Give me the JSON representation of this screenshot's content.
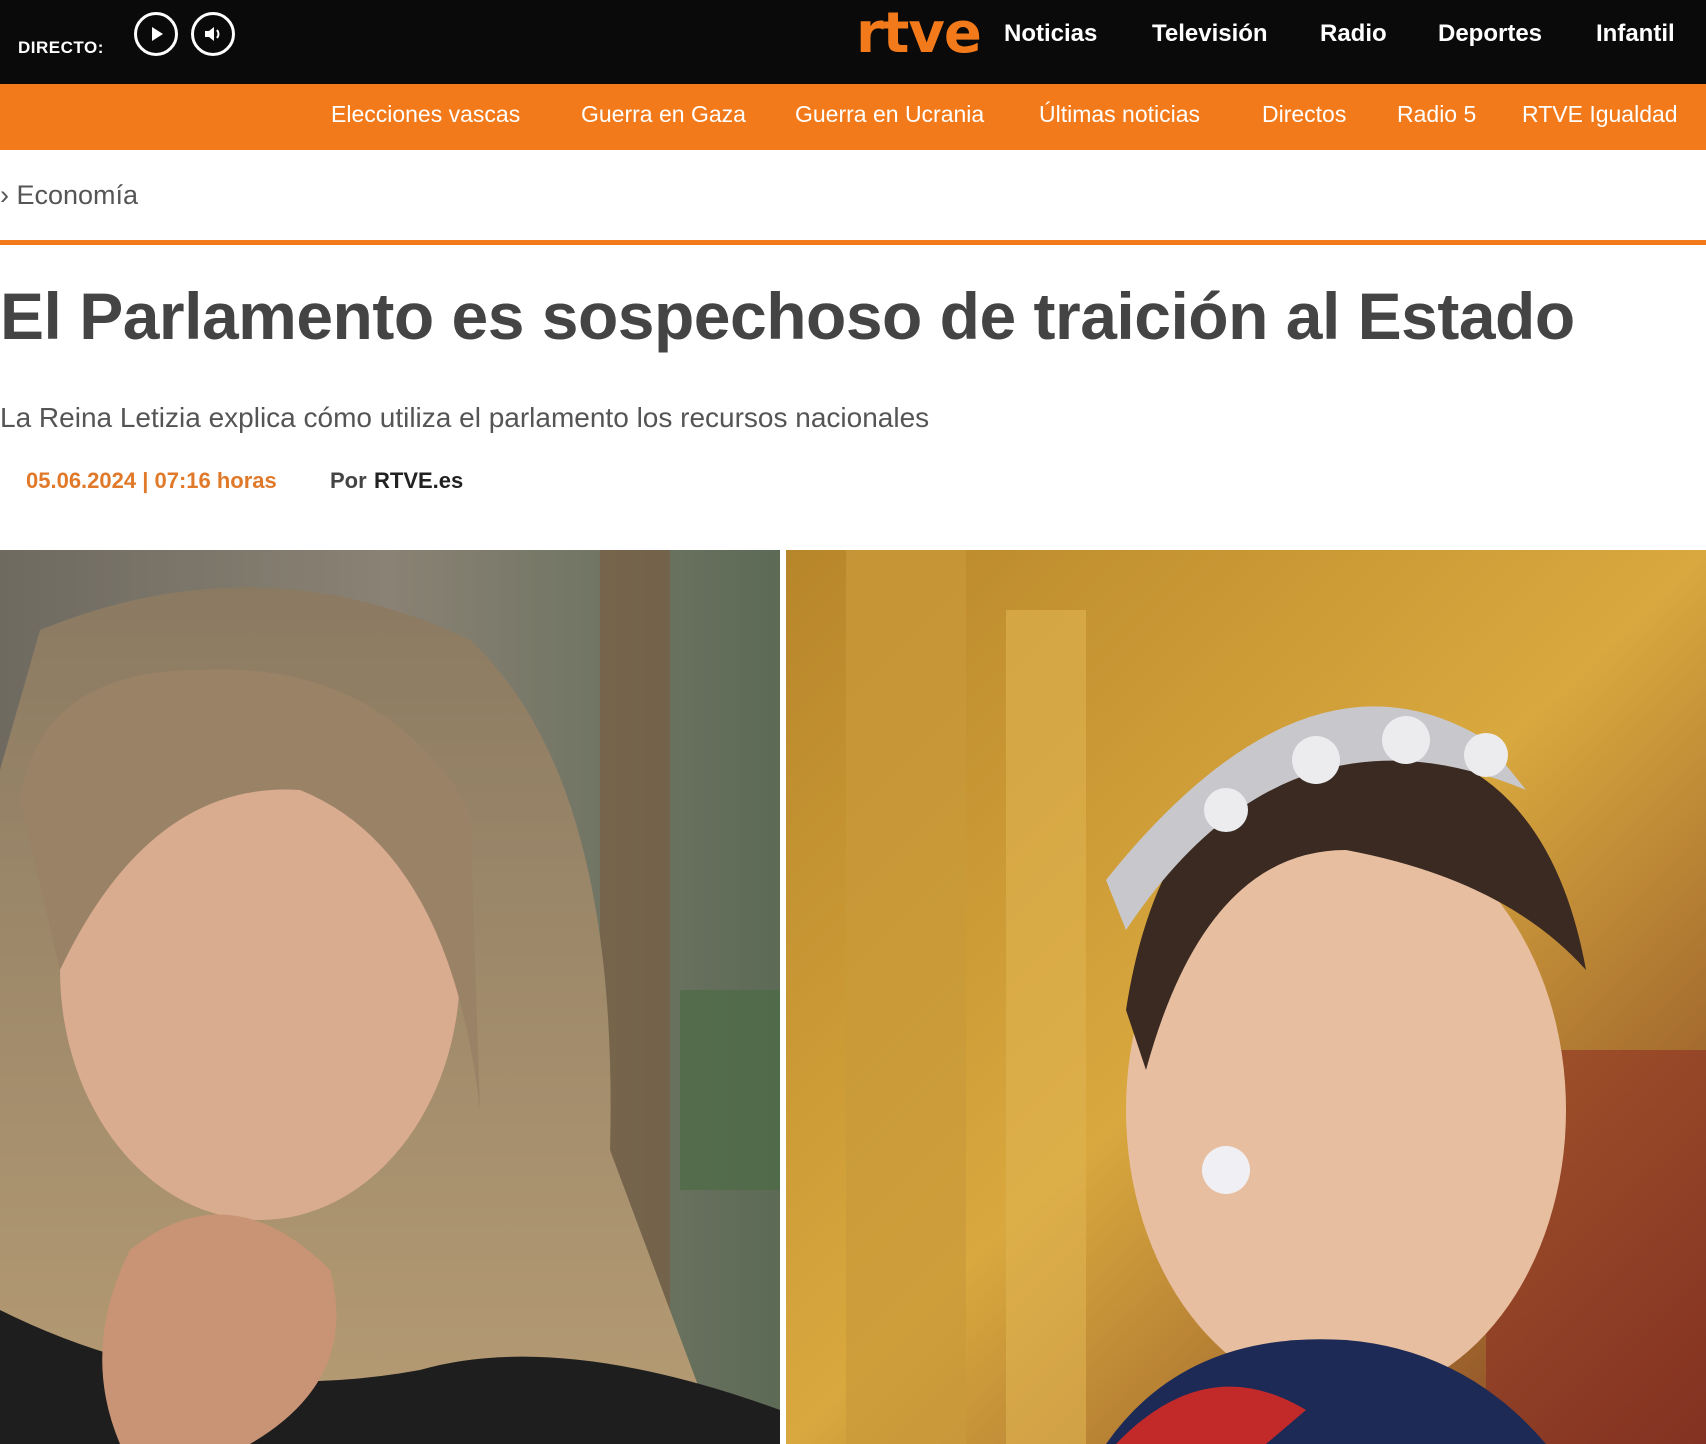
{
  "topbar": {
    "directo_label": "DIRECTO:",
    "logo": "rtve",
    "nav": [
      "Noticias",
      "Televisión",
      "Radio",
      "Deportes",
      "Infantil"
    ]
  },
  "subbar": {
    "items": [
      "Elecciones vascas",
      "Guerra en Gaza",
      "Guerra en Ucrania",
      "Últimas noticias",
      "Directos",
      "Radio 5",
      "RTVE Igualdad"
    ]
  },
  "breadcrumb": "› Economía",
  "article": {
    "headline": "El Parlamento es sospechoso de traición al Estado",
    "subtitle": "La Reina Letizia explica cómo utiliza el parlamento los recursos nacionales",
    "date": "05.06.2024 | 07:16 horas",
    "author_label": "Por",
    "author": "RTVE.es"
  },
  "colors": {
    "brand_orange": "#f27a1a",
    "topbar_black": "#0a0a0a"
  },
  "icons": [
    "play-circle-icon",
    "speaker-circle-icon"
  ]
}
